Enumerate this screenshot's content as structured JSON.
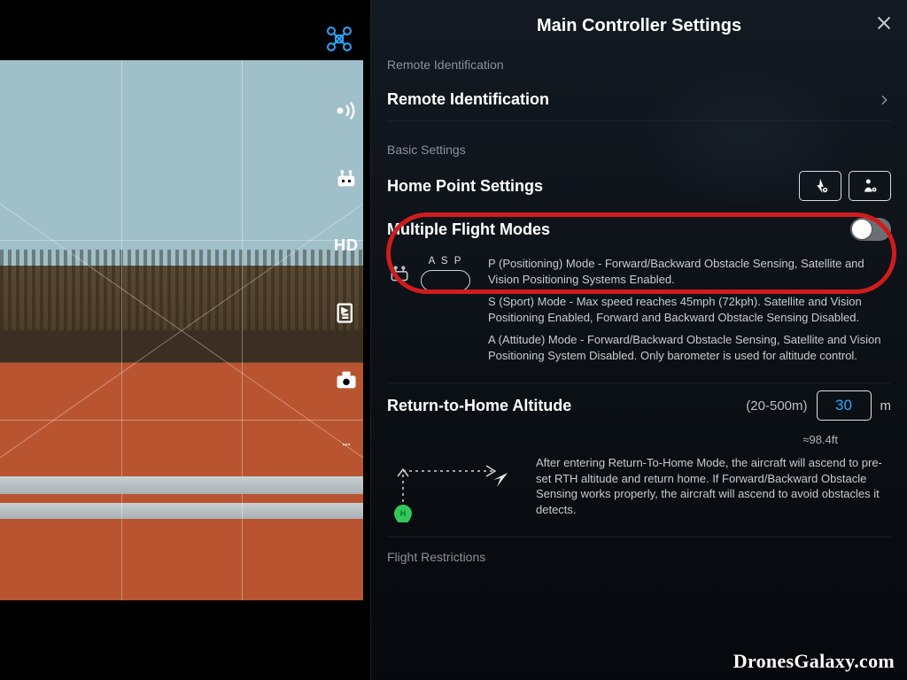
{
  "panel": {
    "title": "Main Controller Settings",
    "sections": {
      "remote_id_label": "Remote Identification",
      "remote_id_item": "Remote Identification",
      "basic_label": "Basic Settings",
      "home_point": "Home Point Settings",
      "multi_flight": "Multiple Flight Modes",
      "multi_flight_on": false,
      "mode_switch_letters": "A S P",
      "mode_desc_p": "P (Positioning) Mode - Forward/Backward Obstacle Sensing, Satellite and Vision Positioning Systems Enabled.",
      "mode_desc_s": "S (Sport) Mode - Max speed reaches 45mph (72kph). Satellite and Vision Positioning Enabled, Forward and Backward Obstacle Sensing Disabled.",
      "mode_desc_a": "A (Attitude) Mode - Forward/Backward Obstacle Sensing, Satellite and Vision Positioning System Disabled. Only barometer is used for altitude control.",
      "rth_label": "Return-to-Home Altitude",
      "rth_range": "(20-500m)",
      "rth_value": "30",
      "rth_unit": "m",
      "rth_approx": "≈98.4ft",
      "rth_desc": "After entering Return-To-Home Mode, the aircraft will ascend to pre-set RTH altitude and return home. If Forward/Backward Obstacle Sensing works properly, the aircraft will ascend to avoid obstacles it detects.",
      "flight_restrictions_label": "Flight Restrictions"
    }
  },
  "sidebar": {
    "items": [
      "signal",
      "remote-controller",
      "hd",
      "sensors",
      "camera",
      "more"
    ]
  },
  "watermark": "DronesGalaxy.com",
  "accent": "#2aa8ff"
}
